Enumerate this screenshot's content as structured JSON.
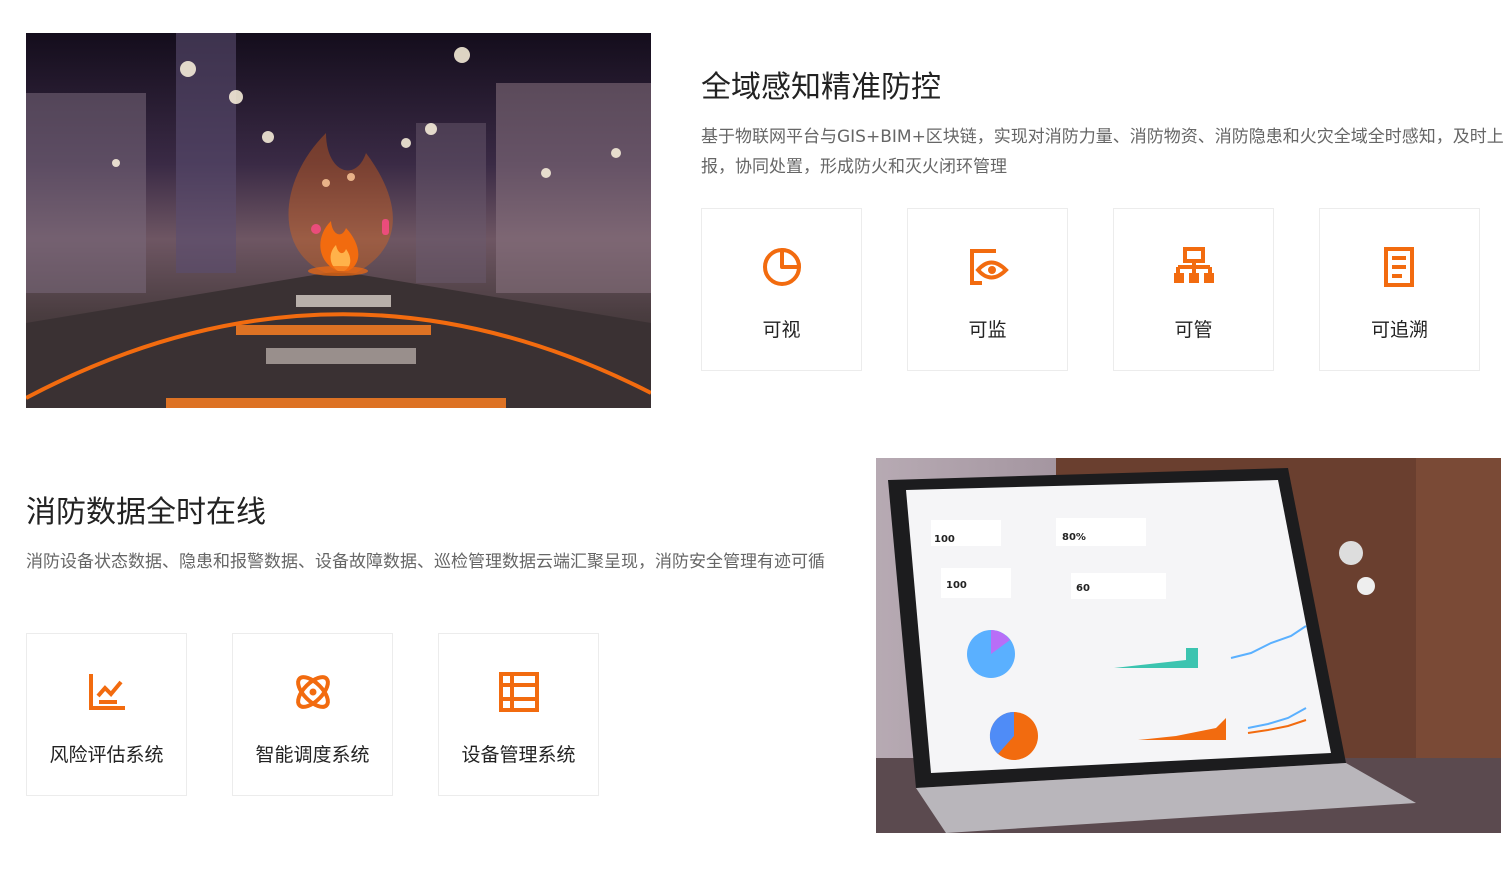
{
  "section1": {
    "title": "全域感知精准防控",
    "desc": "基于物联网平台与GIS+BIM+区块链，实现对消防力量、消防物资、消防隐患和火灾全域全时感知，及时上报，协同处置，形成防火和灭火闭环管理",
    "features": [
      {
        "label": "可视",
        "icon": "pie-chart-icon"
      },
      {
        "label": "可监",
        "icon": "eye-monitor-icon"
      },
      {
        "label": "可管",
        "icon": "network-hierarchy-icon"
      },
      {
        "label": "可追溯",
        "icon": "document-list-icon"
      }
    ]
  },
  "section2": {
    "title": "消防数据全时在线",
    "desc": "消防设备状态数据、隐患和报警数据、设备故障数据、巡检管理数据云端汇聚呈现，消防安全管理有迹可循",
    "features": [
      {
        "label": "风险评估系统",
        "icon": "trend-chart-icon"
      },
      {
        "label": "智能调度系统",
        "icon": "orbit-dispatch-icon"
      },
      {
        "label": "设备管理系统",
        "icon": "list-manage-icon"
      }
    ]
  },
  "colors": {
    "accent": "#f26b0f",
    "title": "#222222",
    "desc": "#666666",
    "card_border": "#ececec"
  },
  "laptop_dashboard": {
    "stat1_value": "100",
    "stat2_value": "80%",
    "stat3_value": "100",
    "stat4_value": "60"
  }
}
